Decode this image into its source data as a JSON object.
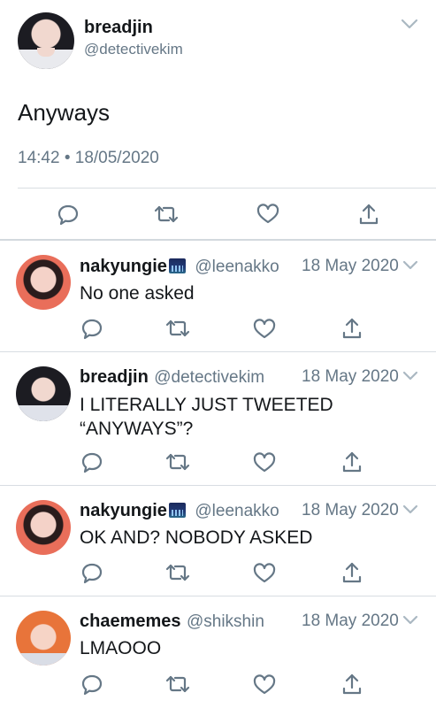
{
  "main_tweet": {
    "author_name": "breadjin",
    "author_handle": "@detectivekim",
    "text": "Anyways",
    "timestamp": "14:42 • 18/05/2020"
  },
  "replies": [
    {
      "author_name": "nakyungie",
      "author_handle": "@leenakko",
      "date": "18 May 2020",
      "text": "No one asked",
      "has_emoji": true
    },
    {
      "author_name": "breadjin",
      "author_handle": "@detectivekim",
      "date": "18 May 2020",
      "text": "I LITERALLY JUST TWEETED “ANYWAYS”?",
      "has_emoji": false
    },
    {
      "author_name": "nakyungie",
      "author_handle": "@leenakko",
      "date": "18 May 2020",
      "text": "OK AND? NOBODY ASKED",
      "has_emoji": true
    },
    {
      "author_name": "chaememes",
      "author_handle": "@shikshin",
      "date": "18 May 2020",
      "text": "LMAOOO",
      "has_emoji": false
    }
  ],
  "icons": {
    "reply": "reply-icon",
    "retweet": "retweet-icon",
    "like": "like-icon",
    "share": "share-icon",
    "more": "chevron-down-icon"
  },
  "colors": {
    "text": "#14171a",
    "secondary": "#657786",
    "divider": "#d8dde2"
  }
}
